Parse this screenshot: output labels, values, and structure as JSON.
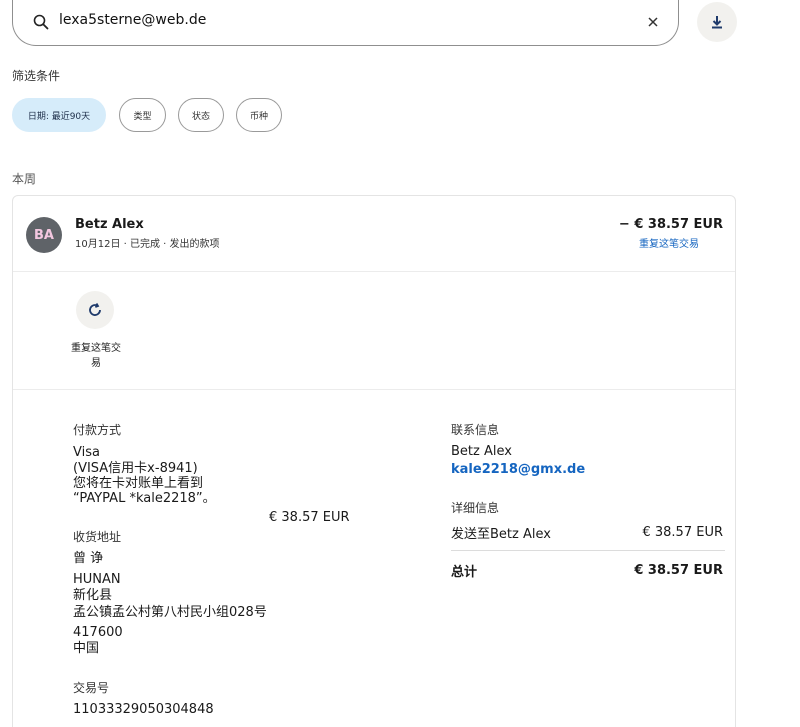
{
  "search": {
    "value": "lexa5sterne@web.de"
  },
  "filters": {
    "title": "筛选条件",
    "chips": [
      {
        "label": "日期: 最近90天",
        "active": true
      },
      {
        "label": "类型",
        "active": false
      },
      {
        "label": "状态",
        "active": false
      },
      {
        "label": "币种",
        "active": false
      }
    ]
  },
  "section_label": "本周",
  "transaction": {
    "avatar_initials": "BA",
    "name": "Betz Alex",
    "meta": "10月12日 · 已完成 · 发出的款项",
    "amount": "− € 38.57 EUR",
    "repeat_link": "重复这笔交易",
    "repeat_button_label": "重复这笔交易"
  },
  "details": {
    "payment_method": {
      "title": "付款方式",
      "line1": "Visa",
      "line2": "(VISA信用卡x-8941)",
      "line3": "您将在卡对账单上看到",
      "line4": "“PAYPAL *kale2218”。",
      "amount": "€ 38.57 EUR"
    },
    "shipping": {
      "title": "收货地址",
      "name": "曾 诤",
      "province": "HUNAN",
      "county": "新化县",
      "street": "孟公镇孟公村第八村民小组028号",
      "postal": "417600",
      "country": "中国"
    },
    "transaction_id": {
      "title": "交易号",
      "value": "11033329050304848"
    },
    "contact": {
      "title": "联系信息",
      "name": "Betz Alex",
      "email": "kale2218@gmx.de"
    },
    "info": {
      "title": "详细信息",
      "sent_to_label": "发送至Betz Alex",
      "sent_to_amount": "€ 38.57 EUR",
      "total_label": "总计",
      "total_amount": "€ 38.57 EUR"
    }
  },
  "colors": {
    "link": "#1565c0",
    "chip_active_bg": "#d6ecfa",
    "avatar_bg": "#5f6368"
  }
}
